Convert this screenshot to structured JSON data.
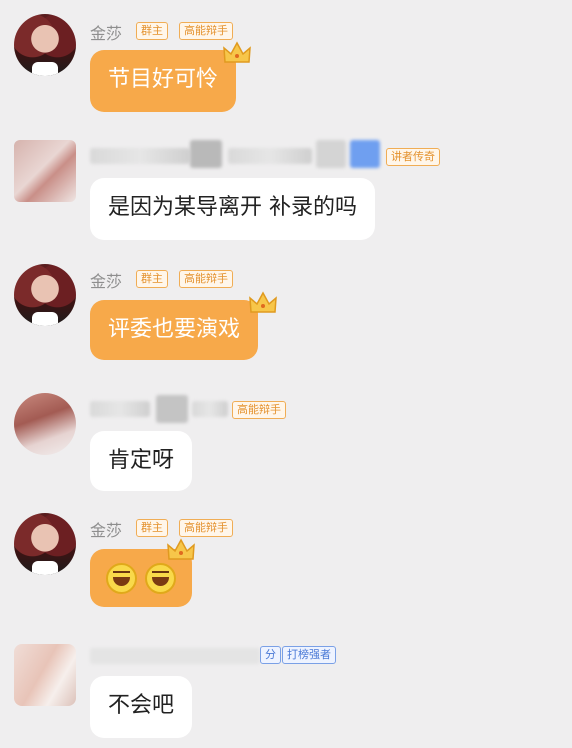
{
  "messages": [
    {
      "sender": "金莎",
      "badges": [
        "群主",
        "高能辩手"
      ],
      "text": "节目好可怜",
      "style": "orange"
    },
    {
      "sender": "",
      "badges": [
        "讲者传奇"
      ],
      "text": "是因为某导离开   补录的吗",
      "style": "white"
    },
    {
      "sender": "金莎",
      "badges": [
        "群主",
        "高能辩手"
      ],
      "text": "评委也要演戏",
      "style": "orange"
    },
    {
      "sender": "",
      "badges": [
        "高能辩手"
      ],
      "text": "肯定呀",
      "style": "white"
    },
    {
      "sender": "金莎",
      "badges": [
        "群主",
        "高能辩手"
      ],
      "emojis": [
        "laughing-face",
        "laughing-face"
      ],
      "style": "orange"
    },
    {
      "sender": "",
      "badges": [
        "分",
        "打榜强者"
      ],
      "text": "不会吧",
      "style": "white"
    }
  ],
  "colors": {
    "background": "#efeeef",
    "owner_bubble": "#f7a94a",
    "member_bubble": "#ffffff",
    "badge_orange": "#e4922f",
    "badge_blue": "#4a79d6"
  }
}
